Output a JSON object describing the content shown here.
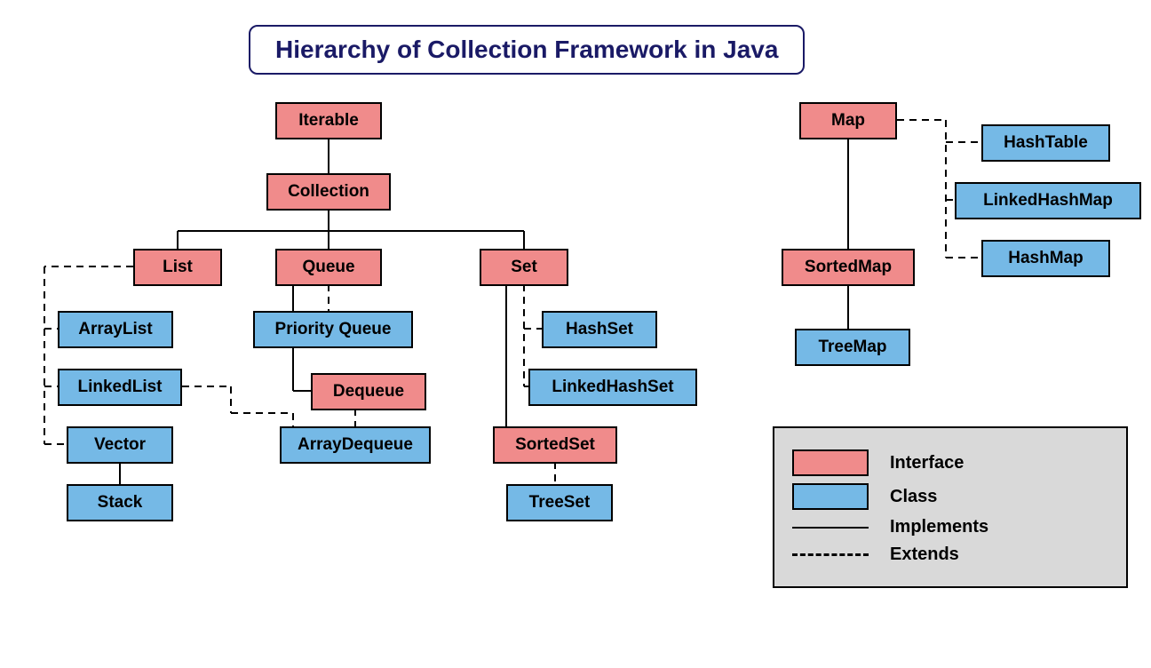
{
  "title": "Hierarchy of Collection Framework in Java",
  "nodes": {
    "iterable": "Iterable",
    "collection": "Collection",
    "list": "List",
    "queue": "Queue",
    "set": "Set",
    "arraylist": "ArrayList",
    "linkedlist": "LinkedList",
    "vector": "Vector",
    "stack": "Stack",
    "priorityqueue": "Priority Queue",
    "dequeue": "Dequeue",
    "arraydequeue": "ArrayDequeue",
    "hashset": "HashSet",
    "linkedhashset": "LinkedHashSet",
    "sortedset": "SortedSet",
    "treeset": "TreeSet",
    "map": "Map",
    "sortedmap": "SortedMap",
    "treemap": "TreeMap",
    "hashtable": "HashTable",
    "linkedhashmap": "LinkedHashMap",
    "hashmap": "HashMap"
  },
  "legend": {
    "interface": "Interface",
    "class": "Class",
    "implements": "Implements",
    "extends": "Extends"
  },
  "colors": {
    "interface": "#f08b8b",
    "class": "#75b9e6",
    "title_border": "#1a1a66"
  }
}
